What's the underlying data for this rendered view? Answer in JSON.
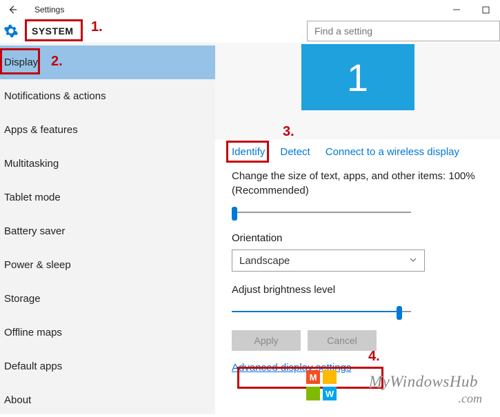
{
  "titlebar": {
    "title": "Settings"
  },
  "header": {
    "section": "SYSTEM"
  },
  "search": {
    "placeholder": "Find a setting"
  },
  "sidebar": {
    "items": [
      {
        "label": "Display",
        "selected": true
      },
      {
        "label": "Notifications & actions"
      },
      {
        "label": "Apps & features"
      },
      {
        "label": "Multitasking"
      },
      {
        "label": "Tablet mode"
      },
      {
        "label": "Battery saver"
      },
      {
        "label": "Power & sleep"
      },
      {
        "label": "Storage"
      },
      {
        "label": "Offline maps"
      },
      {
        "label": "Default apps"
      },
      {
        "label": "About"
      }
    ]
  },
  "display": {
    "monitor_number": "1",
    "links": {
      "identify": "Identify",
      "detect": "Detect",
      "wireless": "Connect to a wireless display"
    },
    "scale_label": "Change the size of text, apps, and other items: 100% (Recommended)",
    "scale_percent": 0,
    "orientation_label": "Orientation",
    "orientation_value": "Landscape",
    "brightness_label": "Adjust brightness level",
    "brightness_percent": 95,
    "buttons": {
      "apply": "Apply",
      "cancel": "Cancel"
    },
    "advanced_link": "Advanced display settings"
  },
  "annotations": {
    "a1": "1.",
    "a2": "2.",
    "a3": "3.",
    "a4": "4."
  },
  "watermark": {
    "site": "MyWindowsHub",
    "tld": ".com",
    "logo_m": "M",
    "logo_w": "W"
  }
}
